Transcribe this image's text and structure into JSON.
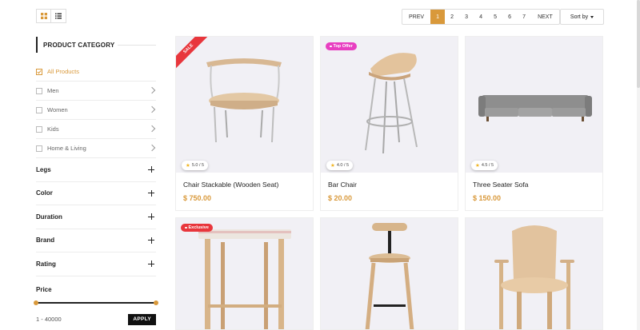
{
  "toolbar": {
    "view_grid_icon": "grid-icon",
    "view_list_icon": "list-icon",
    "pagination": {
      "prev": "PREV",
      "pages": [
        "1",
        "2",
        "3",
        "4",
        "5",
        "6",
        "7"
      ],
      "active": "1",
      "next": "NEXT"
    },
    "sort_label": "Sort by"
  },
  "sidebar": {
    "category_title": "PRODUCT CATEGORY",
    "categories": [
      {
        "label": "All Products",
        "checked": true
      },
      {
        "label": "Men",
        "checked": false
      },
      {
        "label": "Women",
        "checked": false
      },
      {
        "label": "Kids",
        "checked": false
      },
      {
        "label": "Home & Living",
        "checked": false
      }
    ],
    "filters": [
      "Legs",
      "Color",
      "Duration",
      "Brand",
      "Rating"
    ],
    "price": {
      "label": "Price",
      "range": "1 - 40000",
      "apply": "APPLY"
    }
  },
  "products": [
    {
      "name": "Chair Stackable (Wooden Seat)",
      "price": "$ 750.00",
      "rating": "5.0 / 5",
      "badge": "SALE"
    },
    {
      "name": "Bar Chair",
      "price": "$ 20.00",
      "rating": "4.0 / 5",
      "badge": "Top Offer"
    },
    {
      "name": "Three Seater Sofa",
      "price": "$ 150.00",
      "rating": "4.5 / 5",
      "badge": ""
    },
    {
      "name": "",
      "price": "",
      "rating": "",
      "badge": "Exclusive"
    },
    {
      "name": "",
      "price": "",
      "rating": "",
      "badge": ""
    },
    {
      "name": "",
      "price": "",
      "rating": "",
      "badge": ""
    }
  ],
  "colors": {
    "accent": "#d9993b",
    "sale": "#e8363c",
    "top_offer": "#e83fc1",
    "card_bg": "#f1f0f5"
  }
}
